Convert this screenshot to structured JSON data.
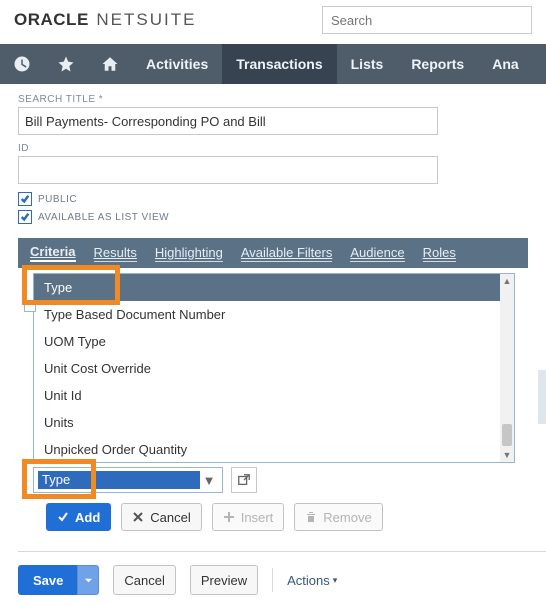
{
  "brand": {
    "oracle": "ORACLE",
    "netsuite": "NETSUITE"
  },
  "search": {
    "placeholder": "Search"
  },
  "nav": {
    "activities": "Activities",
    "transactions": "Transactions",
    "lists": "Lists",
    "reports": "Reports",
    "analytics": "Ana"
  },
  "form": {
    "search_title_label": "SEARCH TITLE *",
    "search_title_value": "Bill Payments- Corresponding PO and Bill",
    "id_label": "ID",
    "id_value": "",
    "public_label": "PUBLIC",
    "available_label": "AVAILABLE AS LIST VIEW"
  },
  "subtabs": {
    "criteria": "Criteria",
    "results": "Results",
    "highlighting": "Highlighting",
    "available_filters": "Available Filters",
    "audience": "Audience",
    "roles": "Roles"
  },
  "dropdown": {
    "items": [
      "Type",
      "Type Based Document Number",
      "UOM Type",
      "Unit Cost Override",
      "Unit Id",
      "Units",
      "Unpicked Order Quantity"
    ]
  },
  "combo": {
    "value": "Type"
  },
  "row_buttons": {
    "add": "Add",
    "cancel": "Cancel",
    "insert": "Insert",
    "remove": "Remove"
  },
  "bottom": {
    "save": "Save",
    "cancel": "Cancel",
    "preview": "Preview",
    "actions": "Actions"
  }
}
